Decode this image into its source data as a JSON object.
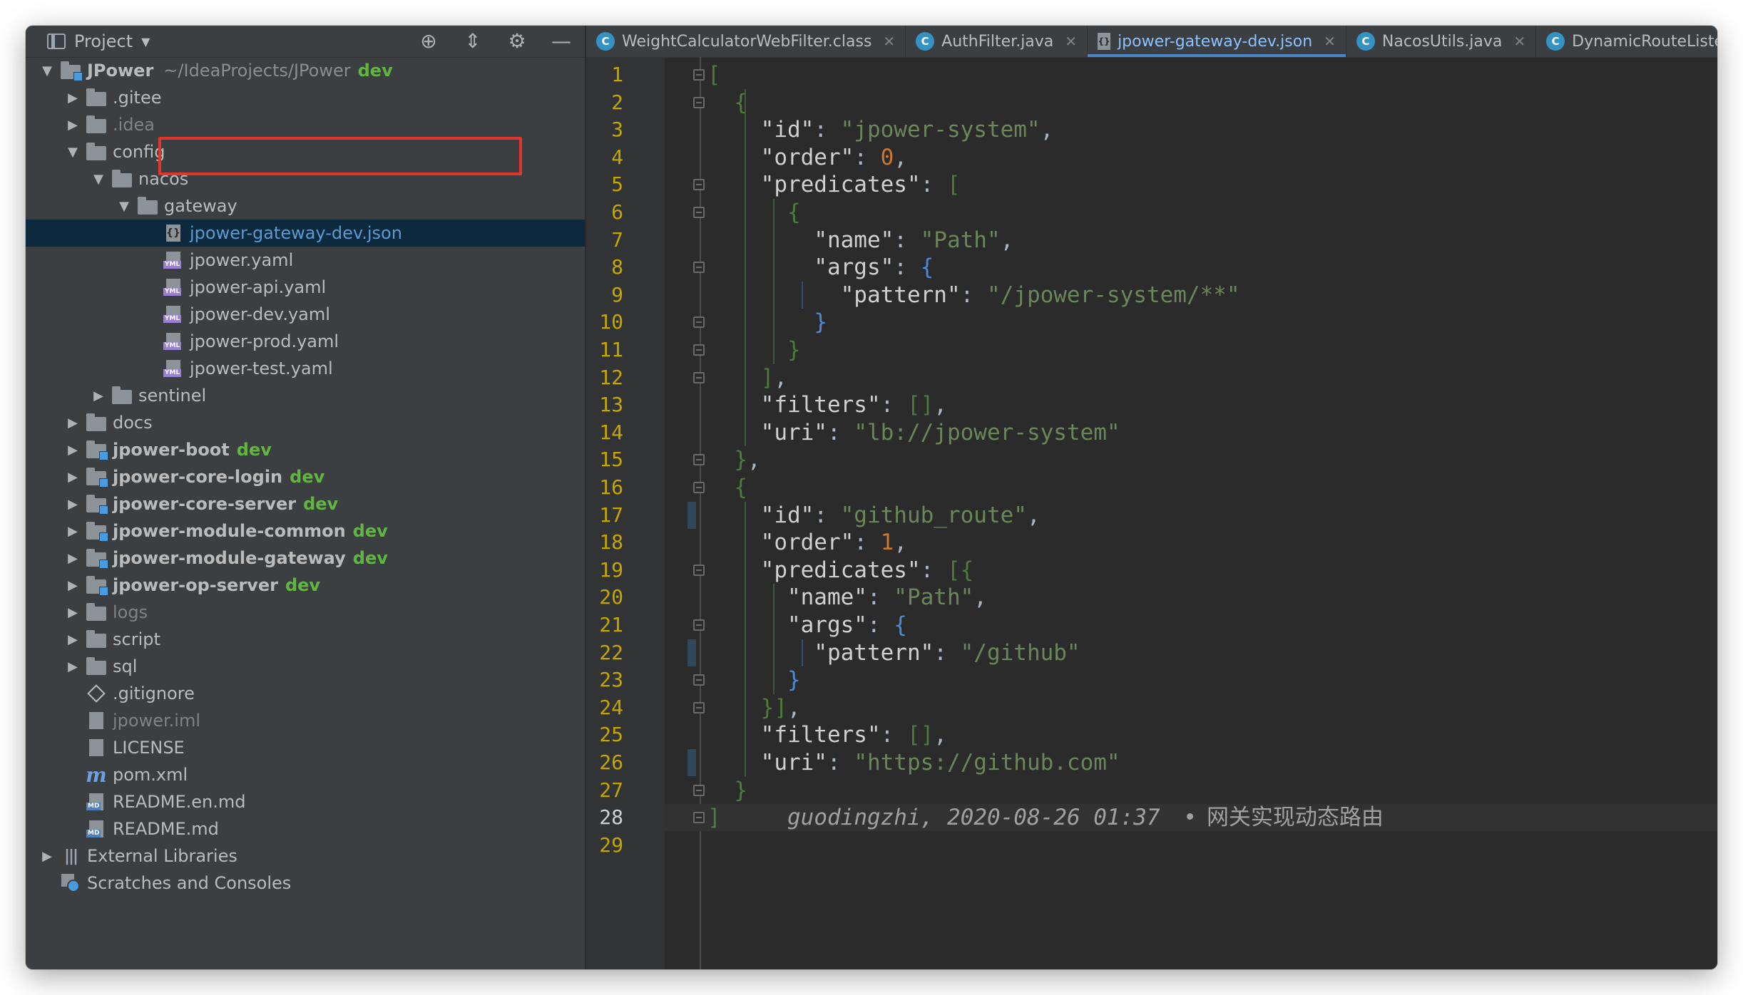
{
  "project_panel": {
    "title": "Project",
    "tree": [
      {
        "indent": 0,
        "arrow": "down",
        "icon": "module-folder",
        "name": "JPower",
        "bold": true,
        "path": "~/IdeaProjects/JPower",
        "branch": "dev"
      },
      {
        "indent": 1,
        "arrow": "right",
        "icon": "folder",
        "name": ".gitee"
      },
      {
        "indent": 1,
        "arrow": "right",
        "icon": "folder",
        "name": ".idea",
        "dim": true
      },
      {
        "indent": 1,
        "arrow": "down",
        "icon": "folder",
        "name": "config"
      },
      {
        "indent": 2,
        "arrow": "down",
        "icon": "folder",
        "name": "nacos"
      },
      {
        "indent": 3,
        "arrow": "down",
        "icon": "folder",
        "name": "gateway"
      },
      {
        "indent": 4,
        "arrow": "",
        "icon": "json-file",
        "name": "jpower-gateway-dev.json",
        "selected": true
      },
      {
        "indent": 4,
        "arrow": "",
        "icon": "yaml-file",
        "name": "jpower.yaml"
      },
      {
        "indent": 4,
        "arrow": "",
        "icon": "yaml-file",
        "name": "jpower-api.yaml"
      },
      {
        "indent": 4,
        "arrow": "",
        "icon": "yaml-file",
        "name": "jpower-dev.yaml"
      },
      {
        "indent": 4,
        "arrow": "",
        "icon": "yaml-file",
        "name": "jpower-prod.yaml"
      },
      {
        "indent": 4,
        "arrow": "",
        "icon": "yaml-file",
        "name": "jpower-test.yaml"
      },
      {
        "indent": 2,
        "arrow": "right",
        "icon": "folder",
        "name": "sentinel"
      },
      {
        "indent": 1,
        "arrow": "right",
        "icon": "folder",
        "name": "docs"
      },
      {
        "indent": 1,
        "arrow": "right",
        "icon": "module-folder",
        "name": "jpower-boot",
        "bold": true,
        "branch": "dev"
      },
      {
        "indent": 1,
        "arrow": "right",
        "icon": "module-folder",
        "name": "jpower-core-login",
        "bold": true,
        "branch": "dev"
      },
      {
        "indent": 1,
        "arrow": "right",
        "icon": "module-folder",
        "name": "jpower-core-server",
        "bold": true,
        "branch": "dev"
      },
      {
        "indent": 1,
        "arrow": "right",
        "icon": "module-folder",
        "name": "jpower-module-common",
        "bold": true,
        "branch": "dev"
      },
      {
        "indent": 1,
        "arrow": "right",
        "icon": "module-folder",
        "name": "jpower-module-gateway",
        "bold": true,
        "branch": "dev"
      },
      {
        "indent": 1,
        "arrow": "right",
        "icon": "module-folder",
        "name": "jpower-op-server",
        "bold": true,
        "branch": "dev"
      },
      {
        "indent": 1,
        "arrow": "right",
        "icon": "folder",
        "name": "logs",
        "dim": true
      },
      {
        "indent": 1,
        "arrow": "right",
        "icon": "folder",
        "name": "script"
      },
      {
        "indent": 1,
        "arrow": "right",
        "icon": "folder",
        "name": "sql"
      },
      {
        "indent": 1,
        "arrow": "",
        "icon": "git-file",
        "name": ".gitignore"
      },
      {
        "indent": 1,
        "arrow": "",
        "icon": "iml-file",
        "name": "jpower.iml",
        "dim": true
      },
      {
        "indent": 1,
        "arrow": "",
        "icon": "text-file",
        "name": "LICENSE"
      },
      {
        "indent": 1,
        "arrow": "",
        "icon": "maven-file",
        "name": "pom.xml"
      },
      {
        "indent": 1,
        "arrow": "",
        "icon": "md-file",
        "name": "README.en.md"
      },
      {
        "indent": 1,
        "arrow": "",
        "icon": "md-file",
        "name": "README.md"
      },
      {
        "indent": 0,
        "arrow": "right",
        "icon": "library",
        "name": "External Libraries"
      },
      {
        "indent": 0,
        "arrow": "",
        "icon": "scratches",
        "name": "Scratches and Consoles"
      }
    ]
  },
  "editor": {
    "tabs": [
      {
        "label": "WeightCalculatorWebFilter.class",
        "icon": "class-icon",
        "closable": true
      },
      {
        "label": "AuthFilter.java",
        "icon": "class-icon",
        "closable": true
      },
      {
        "label": "jpower-gateway-dev.json",
        "icon": "json-icon",
        "closable": true,
        "active": true
      },
      {
        "label": "NacosUtils.java",
        "icon": "class-icon",
        "closable": true
      },
      {
        "label": "DynamicRouteListe",
        "icon": "class-icon",
        "closable": false
      }
    ],
    "current_line": 28,
    "blame": {
      "author": "guodingzhi",
      "date": "2020-08-26 01:37",
      "separator": "•",
      "message": "网关实现动态路由"
    },
    "lines": [
      {
        "no": 1,
        "t": [
          [
            "bd",
            "["
          ]
        ]
      },
      {
        "no": 2,
        "t": [
          [
            "b",
            "  "
          ],
          [
            "bd",
            "{"
          ]
        ]
      },
      {
        "no": 3,
        "t": [
          [
            "b",
            "    "
          ],
          [
            "kw",
            "\"id\""
          ],
          [
            "b",
            ": "
          ],
          [
            "s",
            "\"jpower-system\""
          ],
          [
            "b",
            ","
          ]
        ]
      },
      {
        "no": 4,
        "t": [
          [
            "b",
            "    "
          ],
          [
            "kw",
            "\"order\""
          ],
          [
            "b",
            ": "
          ],
          [
            "o",
            "0"
          ],
          [
            "b",
            ","
          ]
        ]
      },
      {
        "no": 5,
        "t": [
          [
            "b",
            "    "
          ],
          [
            "kw",
            "\"predicates\""
          ],
          [
            "b",
            ": "
          ],
          [
            "bd",
            "["
          ]
        ]
      },
      {
        "no": 6,
        "t": [
          [
            "b",
            "      "
          ],
          [
            "bd",
            "{"
          ]
        ]
      },
      {
        "no": 7,
        "t": [
          [
            "b",
            "        "
          ],
          [
            "kw",
            "\"name\""
          ],
          [
            "b",
            ": "
          ],
          [
            "s",
            "\"Path\""
          ],
          [
            "b",
            ","
          ]
        ]
      },
      {
        "no": 8,
        "t": [
          [
            "b",
            "        "
          ],
          [
            "kw",
            "\"args\""
          ],
          [
            "b",
            ": "
          ],
          [
            "bb",
            "{"
          ]
        ]
      },
      {
        "no": 9,
        "t": [
          [
            "b",
            "          "
          ],
          [
            "kw",
            "\"pattern\""
          ],
          [
            "b",
            ": "
          ],
          [
            "s",
            "\"/jpower-system/**\""
          ]
        ]
      },
      {
        "no": 10,
        "t": [
          [
            "b",
            "        "
          ],
          [
            "bb",
            "}"
          ]
        ]
      },
      {
        "no": 11,
        "t": [
          [
            "b",
            "      "
          ],
          [
            "bd",
            "}"
          ]
        ]
      },
      {
        "no": 12,
        "t": [
          [
            "b",
            "    "
          ],
          [
            "bd",
            "]"
          ],
          [
            "b",
            ","
          ]
        ]
      },
      {
        "no": 13,
        "t": [
          [
            "b",
            "    "
          ],
          [
            "kw",
            "\"filters\""
          ],
          [
            "b",
            ": "
          ],
          [
            "bd",
            "[]"
          ],
          [
            "b",
            ","
          ]
        ]
      },
      {
        "no": 14,
        "t": [
          [
            "b",
            "    "
          ],
          [
            "kw",
            "\"uri\""
          ],
          [
            "b",
            ": "
          ],
          [
            "s",
            "\"lb://jpower-system\""
          ]
        ]
      },
      {
        "no": 15,
        "t": [
          [
            "b",
            "  "
          ],
          [
            "bd",
            "}"
          ],
          [
            "b",
            ","
          ]
        ]
      },
      {
        "no": 16,
        "t": [
          [
            "b",
            "  "
          ],
          [
            "bd",
            "{"
          ]
        ]
      },
      {
        "no": 17,
        "t": [
          [
            "b",
            "    "
          ],
          [
            "kw",
            "\"id\""
          ],
          [
            "b",
            ": "
          ],
          [
            "s",
            "\"github_route\""
          ],
          [
            "b",
            ","
          ]
        ]
      },
      {
        "no": 18,
        "t": [
          [
            "b",
            "    "
          ],
          [
            "kw",
            "\"order\""
          ],
          [
            "b",
            ": "
          ],
          [
            "o",
            "1"
          ],
          [
            "b",
            ","
          ]
        ]
      },
      {
        "no": 19,
        "t": [
          [
            "b",
            "    "
          ],
          [
            "kw",
            "\"predicates\""
          ],
          [
            "b",
            ": "
          ],
          [
            "bd",
            "[{"
          ]
        ]
      },
      {
        "no": 20,
        "t": [
          [
            "b",
            "      "
          ],
          [
            "kw",
            "\"name\""
          ],
          [
            "b",
            ": "
          ],
          [
            "s",
            "\"Path\""
          ],
          [
            "b",
            ","
          ]
        ]
      },
      {
        "no": 21,
        "t": [
          [
            "b",
            "      "
          ],
          [
            "kw",
            "\"args\""
          ],
          [
            "b",
            ": "
          ],
          [
            "bb",
            "{"
          ]
        ]
      },
      {
        "no": 22,
        "t": [
          [
            "b",
            "        "
          ],
          [
            "kw",
            "\"pattern\""
          ],
          [
            "b",
            ": "
          ],
          [
            "s",
            "\"/github\""
          ]
        ]
      },
      {
        "no": 23,
        "t": [
          [
            "b",
            "      "
          ],
          [
            "bb",
            "}"
          ]
        ]
      },
      {
        "no": 24,
        "t": [
          [
            "b",
            "    "
          ],
          [
            "bd",
            "}]"
          ],
          [
            "b",
            ","
          ]
        ]
      },
      {
        "no": 25,
        "t": [
          [
            "b",
            "    "
          ],
          [
            "kw",
            "\"filters\""
          ],
          [
            "b",
            ": "
          ],
          [
            "bd",
            "[]"
          ],
          [
            "b",
            ","
          ]
        ]
      },
      {
        "no": 26,
        "t": [
          [
            "b",
            "    "
          ],
          [
            "kw",
            "\"uri\""
          ],
          [
            "b",
            ": "
          ],
          [
            "s",
            "\"https://github.com\""
          ]
        ]
      },
      {
        "no": 27,
        "t": [
          [
            "b",
            "  "
          ],
          [
            "bd",
            "}"
          ]
        ]
      },
      {
        "no": 28,
        "t": [
          [
            "bd",
            "]"
          ]
        ]
      },
      {
        "no": 29,
        "t": []
      }
    ]
  }
}
